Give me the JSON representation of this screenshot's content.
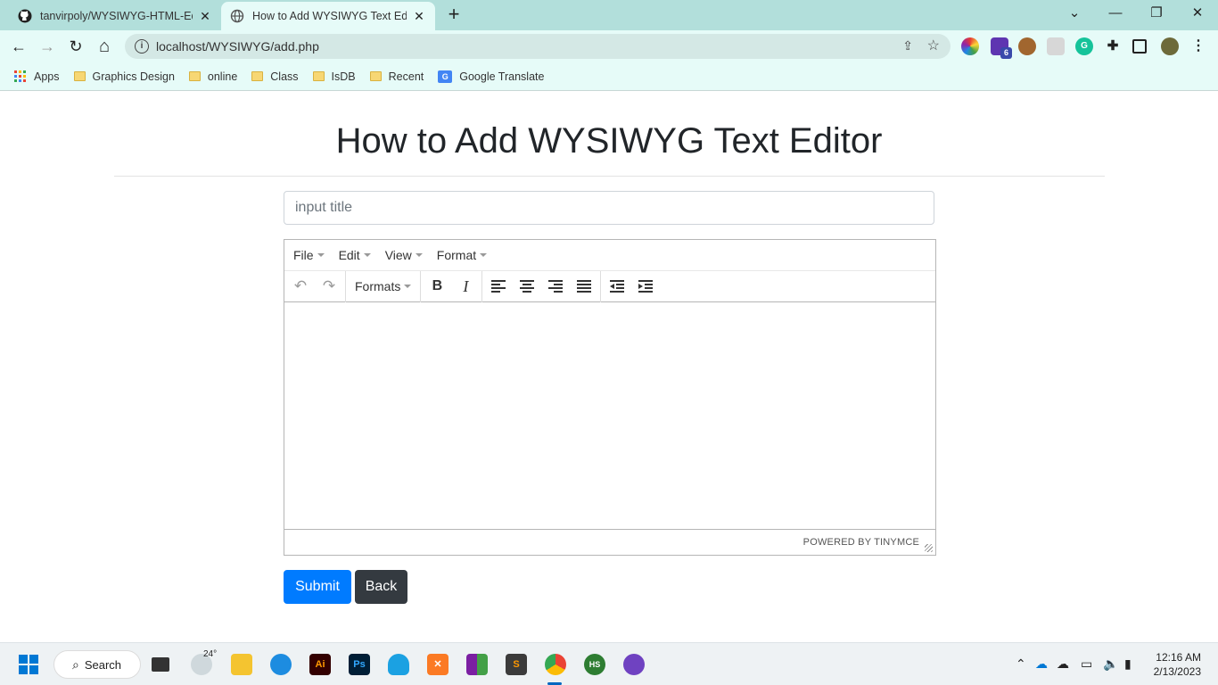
{
  "browser": {
    "tabs": [
      {
        "title": "tanvirpoly/WYSIWYG-HTML-Edito",
        "icon": "github-icon",
        "active": false
      },
      {
        "title": "How to Add WYSIWYG Text Edito",
        "icon": "globe-icon",
        "active": true
      }
    ],
    "new_tab": "+",
    "window_controls": {
      "dropdown": "⌄",
      "minimize": "—",
      "maximize": "❐",
      "close": "✕"
    },
    "nav": {
      "back": "←",
      "forward": "→",
      "reload": "↻",
      "home": "⌂"
    },
    "address": "localhost/WYSIWYG/add.php",
    "extension_badge": "6",
    "bookmarks": [
      "Apps",
      "Graphics Design",
      "online",
      "Class",
      "IsDB",
      "Recent",
      "Google Translate"
    ]
  },
  "page": {
    "heading": "How to Add WYSIWYG Text Editor",
    "title_input": {
      "placeholder": "input title",
      "value": ""
    },
    "editor": {
      "menus": [
        "File",
        "Edit",
        "View",
        "Format"
      ],
      "formats_label": "Formats",
      "bold_label": "B",
      "italic_label": "I",
      "powered_by": "POWERED BY TINYMCE"
    },
    "buttons": {
      "submit": "Submit",
      "back": "Back"
    }
  },
  "taskbar": {
    "search_label": "Search",
    "weather_temp": "24°",
    "time": "12:16 AM",
    "date": "2/13/2023",
    "apps": [
      "Task View",
      "Weather",
      "File Explorer",
      "Edge",
      "Illustrator",
      "Photoshop",
      "App",
      "XAMPP",
      "WinRAR",
      "Sublime Text",
      "Chrome",
      "HeidiSQL",
      "GitHub Desktop"
    ]
  },
  "colors": {
    "primary": "#007bff",
    "dark": "#343a40",
    "tab_bg": "#b2dfdb",
    "toolbar_bg": "#e6fbf8"
  }
}
